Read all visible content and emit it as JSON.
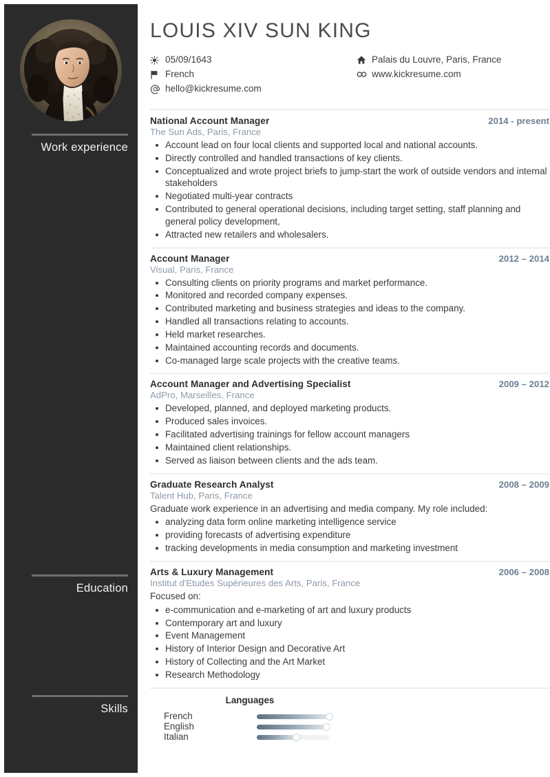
{
  "sidebar": {
    "photo_alt": "portrait-louis-xiv",
    "sections": [
      {
        "label": "Work experience"
      },
      {
        "label": "Education"
      },
      {
        "label": "Skills"
      }
    ]
  },
  "header": {
    "name": "LOUIS XIV SUN KING",
    "contacts_left": [
      {
        "icon": "sun-icon",
        "text": "05/09/1643"
      },
      {
        "icon": "flag-icon",
        "text": "French"
      },
      {
        "icon": "at-icon",
        "text": "hello@kickresume.com"
      }
    ],
    "contacts_right": [
      {
        "icon": "home-icon",
        "text": "Palais du Louvre, Paris, France"
      },
      {
        "icon": "link-icon",
        "text": "www.kickresume.com"
      }
    ]
  },
  "experience": [
    {
      "title": "National Account Manager",
      "date": "2014 - present",
      "subtitle": "The Sun Ads, Paris, France",
      "intro": "",
      "bullets": [
        "Account lead on four local clients and supported local and national accounts.",
        "Directly controlled and handled transactions of key clients.",
        "Conceptualized and wrote project briefs to jump-start the work of outside vendors and internal stakeholders",
        "Negotiated multi-year contracts",
        "Contributed to general operational decisions, including target setting, staff planning and general policy development,",
        "Attracted new retailers and wholesalers."
      ]
    },
    {
      "title": "Account Manager",
      "date": "2012 – 2014",
      "subtitle": "Visual, Paris, France",
      "intro": "",
      "bullets": [
        "Consulting clients on priority programs and market performance.",
        "Monitored and recorded company expenses.",
        "Contributed marketing and business strategies and ideas to the company.",
        "Handled all transactions relating to accounts.",
        "Held market researches.",
        "Maintained accounting records and documents.",
        "Co-managed large scale projects with the creative teams."
      ]
    },
    {
      "title": "Account Manager and Advertising Specialist",
      "date": "2009 – 2012",
      "subtitle": "AdPro, Marseilles, France",
      "intro": "",
      "bullets": [
        "Developed, planned, and deployed marketing products.",
        "Produced sales invoices.",
        "Facilitated advertising trainings for fellow account managers",
        "Maintained client relationships.",
        "Served as liaison between clients and the ads team."
      ]
    },
    {
      "title": "Graduate Research Analyst",
      "date": "2008 – 2009",
      "subtitle": "Talent Hub, Paris, France",
      "intro": "Graduate work experience in an advertising and media company. My role included:",
      "bullets": [
        "analyzing data form online marketing intelligence service",
        "providing forecasts of advertising expenditure",
        "tracking developments in media consumption and marketing investment"
      ]
    }
  ],
  "education": [
    {
      "title": "Arts & Luxury Management",
      "date": "2006 – 2008",
      "subtitle": "Institut d'Etudes Supérieures des Arts, Paris, France",
      "intro": "Focused on:",
      "bullets": [
        "e-communication and e-marketing of art and luxury products",
        "Contemporary art and luxury",
        "Event Management",
        "History of Interior Design and Decorative Art",
        "History of Collecting and the Art Market",
        "Research Methodology"
      ]
    }
  ],
  "skills": {
    "group_title": "Languages",
    "items": [
      {
        "label": "French",
        "level": 100
      },
      {
        "label": "English",
        "level": 97
      },
      {
        "label": "Italian",
        "level": 55
      }
    ]
  },
  "colors": {
    "sidebar_bg": "#2b2b2b",
    "date_accent": "#6d7f93",
    "subtitle": "#8d9aa8",
    "body_text": "#3a3a3a",
    "divider": "#eceef0"
  }
}
